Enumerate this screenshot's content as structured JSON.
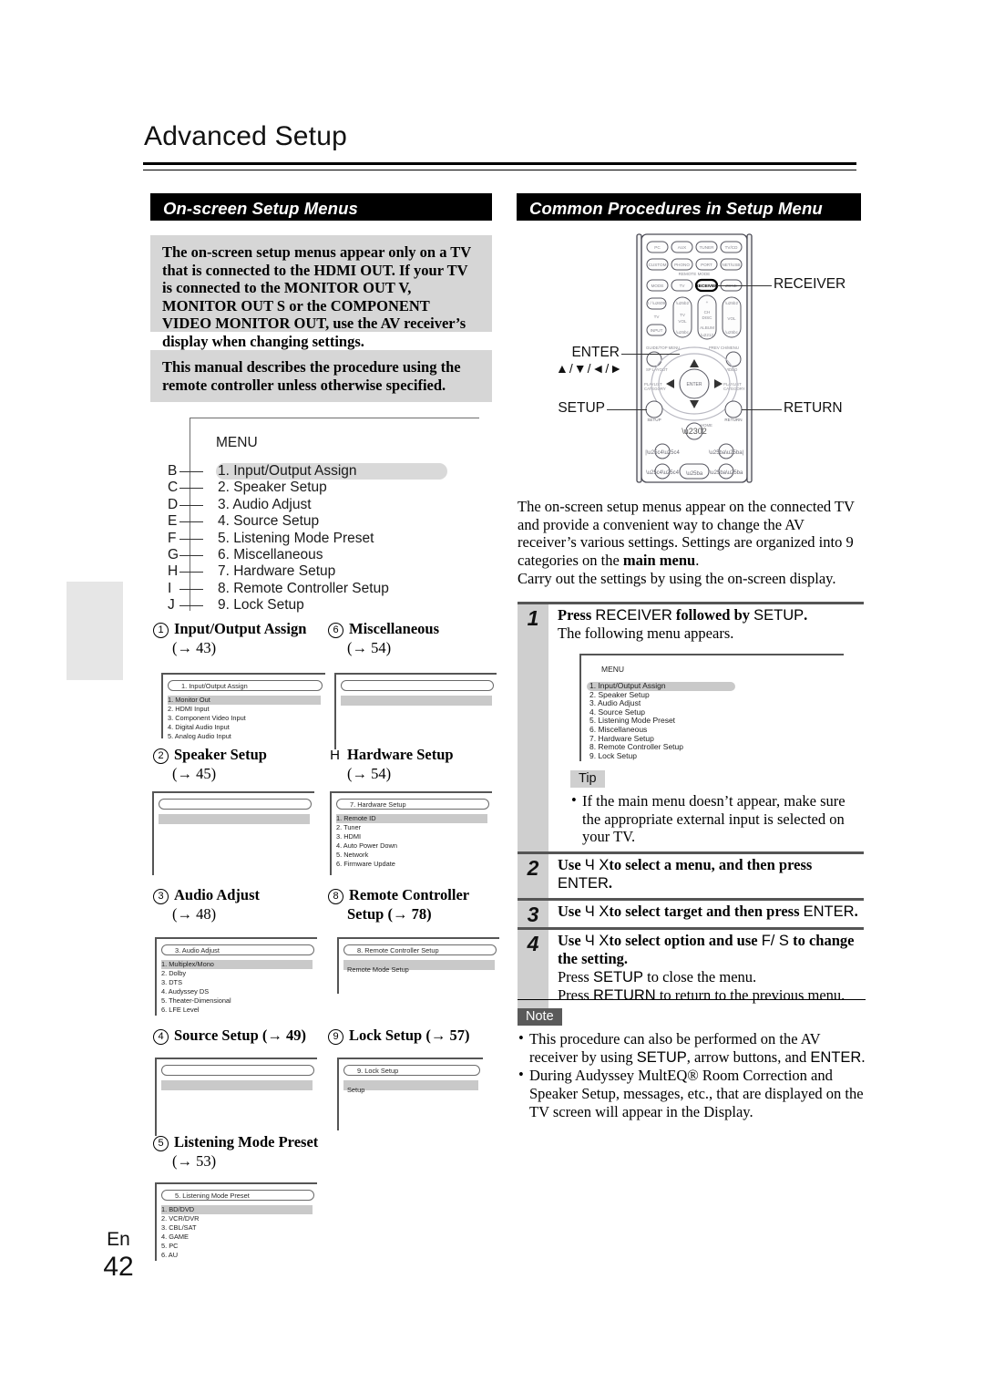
{
  "page": {
    "title": "Advanced Setup",
    "language_code": "En",
    "page_number": "42"
  },
  "sections": {
    "left_heading": "On-screen Setup Menus",
    "right_heading": "Common Procedures in Setup Menu"
  },
  "notices": [
    "The on-screen setup menus appear only on a TV that is connected to the HDMI OUT. If your TV is connected to the MONITOR OUT V, MONITOR OUT S or the COMPONENT VIDEO MONITOR OUT, use the AV receiver’s display when changing settings.",
    "This manual describes the procedure using the remote controller unless otherwise specified."
  ],
  "menu_diagram": {
    "caption": "MENU",
    "letters": [
      "B",
      "C",
      "D",
      "E",
      "F",
      "G",
      "H",
      "I",
      "J"
    ],
    "items": [
      "1. Input/Output Assign",
      "2. Speaker Setup",
      "3. Audio Adjust",
      "4. Source Setup",
      "5. Listening Mode Preset",
      "6. Miscellaneous",
      "7. Hardware Setup",
      "8. Remote Controller Setup",
      "9. Lock Setup"
    ],
    "selected_index": 0
  },
  "entries": [
    {
      "marker": "①",
      "marker_type": "circled",
      "title": "Input/Output Assign",
      "page_ref": "(→ 43)",
      "osd": {
        "tab": "1.   Input/Output Assign",
        "rows": [
          "1.  Monitor Out",
          "2.  HDMI Input",
          "3.  Component Video Input",
          "4.  Digital Audio Input",
          "5.  Analog Audio Input"
        ],
        "selected_index": 0
      }
    },
    {
      "marker": "②",
      "marker_type": "circled",
      "title": "Speaker Setup",
      "page_ref": "(→ 45)",
      "osd": {
        "tab": "",
        "rows": [],
        "selected_index": 0,
        "blank": true
      }
    },
    {
      "marker": "③",
      "marker_type": "circled",
      "title": "Audio Adjust",
      "page_ref": "(→ 48)",
      "osd": {
        "tab": "3.   Audio Adjust",
        "rows": [
          "1.  Multiplex/Mono",
          "2.  Dolby",
          "3.  DTS",
          "4.  Audyssey DS",
          "5.  Theater-Dimensional",
          "6.  LFE Level"
        ],
        "selected_index": 0
      }
    },
    {
      "marker": "④",
      "marker_type": "circled",
      "title": "Source Setup",
      "page_ref": "(→ 49)",
      "inline_ref": true,
      "osd": {
        "tab": "",
        "rows": [],
        "selected_index": 0,
        "blank": true
      }
    },
    {
      "marker": "⑤",
      "marker_type": "circled",
      "title": "Listening Mode Preset",
      "page_ref": "(→ 53)",
      "osd": {
        "tab": "5.   Listening Mode Preset",
        "rows": [
          "1.  BD/DVD",
          "2.  VCR/DVR",
          "3.  CBL/SAT",
          "4.  GAME",
          "5.  PC",
          "6.  AU"
        ],
        "selected_index": 0
      }
    },
    {
      "marker": "⑥",
      "marker_type": "circled",
      "title": "Miscellaneous",
      "page_ref": "(→ 54)",
      "osd": {
        "tab": "",
        "rows": [],
        "selected_index": 0,
        "blank": true
      }
    },
    {
      "marker": "H",
      "marker_type": "plain",
      "title": "Hardware Setup",
      "page_ref": "(→ 54)",
      "osd": {
        "tab": "7.   Hardware Setup",
        "rows": [
          "1.  Remote ID",
          "2.  Tuner",
          "3.  HDMI",
          "4.  Auto Power Down",
          "5.  Network",
          "6.  Firmware Update"
        ],
        "selected_index": 0
      }
    },
    {
      "marker": "⑧",
      "marker_type": "circled",
      "title": "Remote Controller",
      "title2": "Setup (→ 78)",
      "osd": {
        "tab": "8.   Remote Controller Setup",
        "bar_label": "Remote Mode Setup",
        "rows": [],
        "selected_index": 0
      }
    },
    {
      "marker": "⑨",
      "marker_type": "circled",
      "title": "Lock Setup",
      "page_ref": "(→ 57)",
      "inline_ref": true,
      "osd": {
        "tab": "9.   Lock Setup",
        "bar_label": "Setup",
        "rows": [],
        "selected_index": 0
      }
    }
  ],
  "remote": {
    "callouts": [
      {
        "name": "RECEIVER",
        "label": "RECEIVER"
      },
      {
        "name": "ENTER",
        "label": "ENTER",
        "sub": "▲/▼/◄/►"
      },
      {
        "name": "SETUP",
        "label": "SETUP"
      },
      {
        "name": "RETURN",
        "label": "RETURN"
      }
    ],
    "buttons_row1": [
      "PC",
      "AUX",
      "TUNER",
      "TV/CD"
    ],
    "buttons_row2": [
      "CUSTOM",
      "PHONO",
      "PORT",
      "NET/USB"
    ],
    "buttons_row3": [
      "MODE",
      "TV",
      "RECEIVER",
      "ZONE"
    ],
    "remote_mode_label": "REMOTE MODE",
    "power_label": "Ⅰ/☉",
    "tv_label": "TV",
    "input_label": "INPUT",
    "tvvol_label": "TV VOL",
    "chdisc_label": "CH DISC",
    "album_label": "ALBUM",
    "vol_label": "VOL",
    "guide_label": "GUIDE/TOP MENU",
    "prev_label": "PREV CH/MENU",
    "splayout_label": "SP LAYOUT",
    "video_label": "VIDEO",
    "playlist_left": "PLAYLIST CATEGORY",
    "playlist_right": "PLAYLIST CATEGORY",
    "enter_label": "ENTER",
    "setup_btn_label": "SETUP",
    "return_btn_label": "RETURN",
    "home_label": "HOME"
  },
  "intro": {
    "p1_a": "The on-screen setup menus appear on the connected TV and provide a convenient way to change the AV receiver’s various settings. Settings are organized into 9 categories on the ",
    "p1_bold": "main menu",
    "p1_b": ".",
    "p2": "Carry out the settings by using the on-screen display."
  },
  "steps": [
    {
      "number": "1",
      "line1_pre": "Press ",
      "line1_k1": "RECEIVER",
      "line1_mid": " followed by ",
      "line1_k2": "SETUP",
      "line1_post": ".",
      "line2": "The following menu appears.",
      "osd": {
        "caption": "MENU",
        "items": [
          "1. Input/Output Assign",
          "2. Speaker Setup",
          "3. Audio Adjust",
          "4. Source Setup",
          "5. Listening Mode Preset",
          "6. Miscellaneous",
          "7. Hardware Setup",
          "8. Remote Controller Setup",
          "9. Lock Setup"
        ],
        "selected_index": 0
      },
      "tip_label": "Tip",
      "tip_bullets": [
        "If the main menu doesn’t appear, make sure the appropriate external input is selected on your TV."
      ]
    },
    {
      "number": "2",
      "line1_pre": "Use ",
      "glyph": "Ч X",
      "line1_mid": "to select a menu, and then press ",
      "line1_k2": "ENTER",
      "line1_post": "."
    },
    {
      "number": "3",
      "line1_pre": "Use ",
      "glyph": "Ч X",
      "line1_mid": "to select target and then press ",
      "line1_k2": "ENTER",
      "line1_post": "."
    },
    {
      "number": "4",
      "line1_pre": "Use ",
      "glyph": "Ч X",
      "line1_mid": "to select option and use ",
      "glyph2": "F/ S",
      "line1_post": " to change the setting.",
      "extra_lines": [
        {
          "pre": "Press ",
          "key": "SETUP",
          "post": " to close the menu."
        },
        {
          "pre": "Press ",
          "key": "RETURN",
          "post": " to return to the previous menu."
        }
      ]
    }
  ],
  "note": {
    "label": "Note",
    "bullets": [
      {
        "pre": "This procedure can also be performed on the AV receiver by using ",
        "k1": "SETUP",
        "mid": ", arrow buttons, and ",
        "k2": "ENTER",
        "post": "."
      },
      {
        "pre": "During Audyssey MultEQ® Room Correction and Speaker Setup, messages, etc., that are displayed on the TV screen will appear in the Display.",
        "k1": "",
        "mid": "",
        "k2": "",
        "post": ""
      }
    ]
  },
  "colors": {
    "bar_bg": "#000000",
    "notice_bg": "#d6d6d6",
    "selected_row": "#c9c9c9",
    "step_col": "#cfcfcf",
    "note_label_bg": "#5a5a5a"
  }
}
